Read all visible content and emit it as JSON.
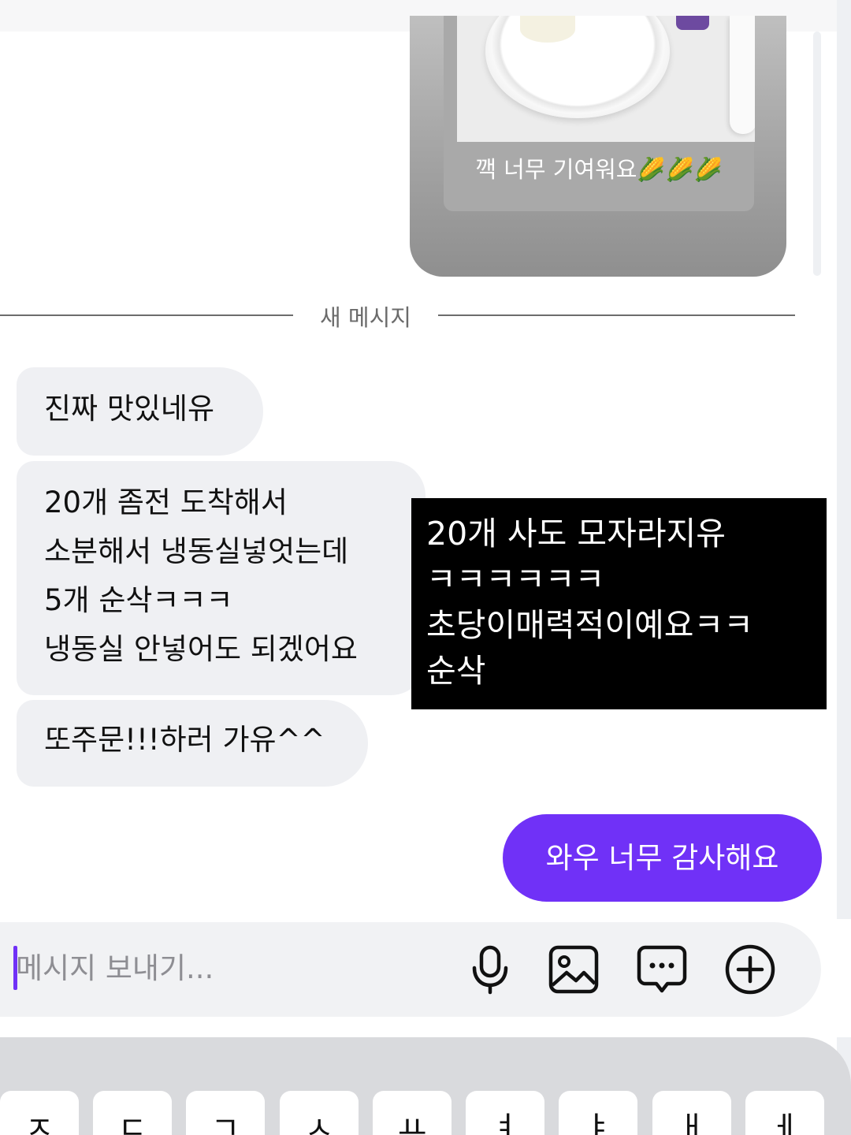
{
  "story": {
    "caption": "깩 너무 기여워요🌽🌽🌽"
  },
  "divider": {
    "label": "새 메시지"
  },
  "received_messages": [
    {
      "text": "진짜 맛있네유"
    },
    {
      "lines": [
        "20개 좀전 도착해서",
        "소분해서 냉동실넣엇는데",
        "5개 순삭ㅋㅋㅋ",
        "냉동실 안넣어도 되겠어요"
      ]
    },
    {
      "text": "또주문!!!하러 가유^^"
    }
  ],
  "overlay_note": {
    "lines": [
      "20개 사도 모자라지유",
      "ㅋㅋㅋㅋㅋㅋ",
      "초당이매력적이예요ㅋㅋ",
      "순삭"
    ]
  },
  "sent_message": {
    "text": "와우 너무 감사해요"
  },
  "composer": {
    "placeholder": "메시지 보내기..."
  },
  "icons": {
    "microphone": "microphone-icon",
    "gallery": "image-icon",
    "sticker": "chat-bubble-icon",
    "more": "plus-circle-icon"
  },
  "keyboard": {
    "keys": [
      "ㅈ",
      "ㄷ",
      "ㄱ",
      "ㅅ",
      "ㅛ",
      "ㅕ",
      "ㅑ",
      "ㅐ",
      "ㅔ"
    ]
  },
  "colors": {
    "accent": "#7031f7",
    "received_bubble": "#eff0f3",
    "overlay": "#000000"
  }
}
